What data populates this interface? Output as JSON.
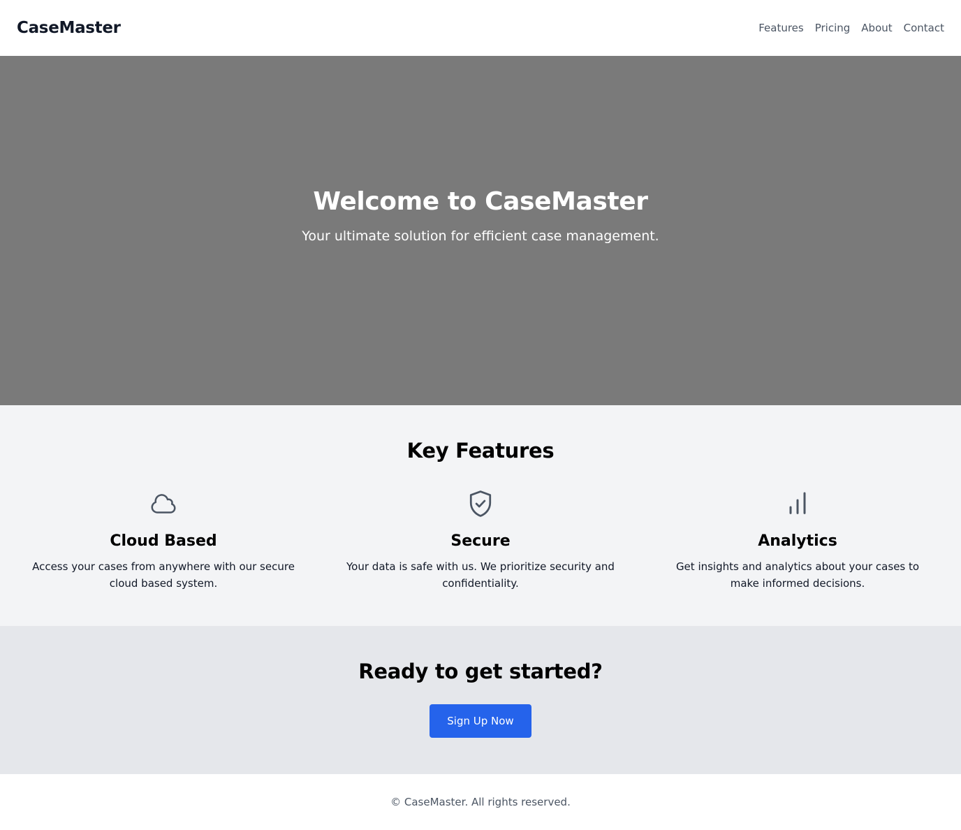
{
  "nav": {
    "brand": "CaseMaster",
    "links": [
      "Features",
      "Pricing",
      "About",
      "Contact"
    ]
  },
  "hero": {
    "title": "Welcome to CaseMaster",
    "subtitle": "Your ultimate solution for efficient case management."
  },
  "features": {
    "title": "Key Features",
    "items": [
      {
        "icon": "cloud-icon",
        "title": "Cloud Based",
        "description": "Access your cases from anywhere with our secure cloud based system."
      },
      {
        "icon": "shield-check-icon",
        "title": "Secure",
        "description": "Your data is safe with us. We prioritize security and confidentiality."
      },
      {
        "icon": "bar-chart-icon",
        "title": "Analytics",
        "description": "Get insights and analytics about your cases to make informed decisions."
      }
    ]
  },
  "cta": {
    "title": "Ready to get started?",
    "button_label": "Sign Up Now"
  },
  "footer": {
    "text": "© CaseMaster. All rights reserved."
  },
  "colors": {
    "accent": "#2563eb",
    "hero_bg": "#7a7a7a",
    "features_bg": "#f3f4f6",
    "cta_bg": "#e5e7eb",
    "icon": "#4b5563"
  }
}
